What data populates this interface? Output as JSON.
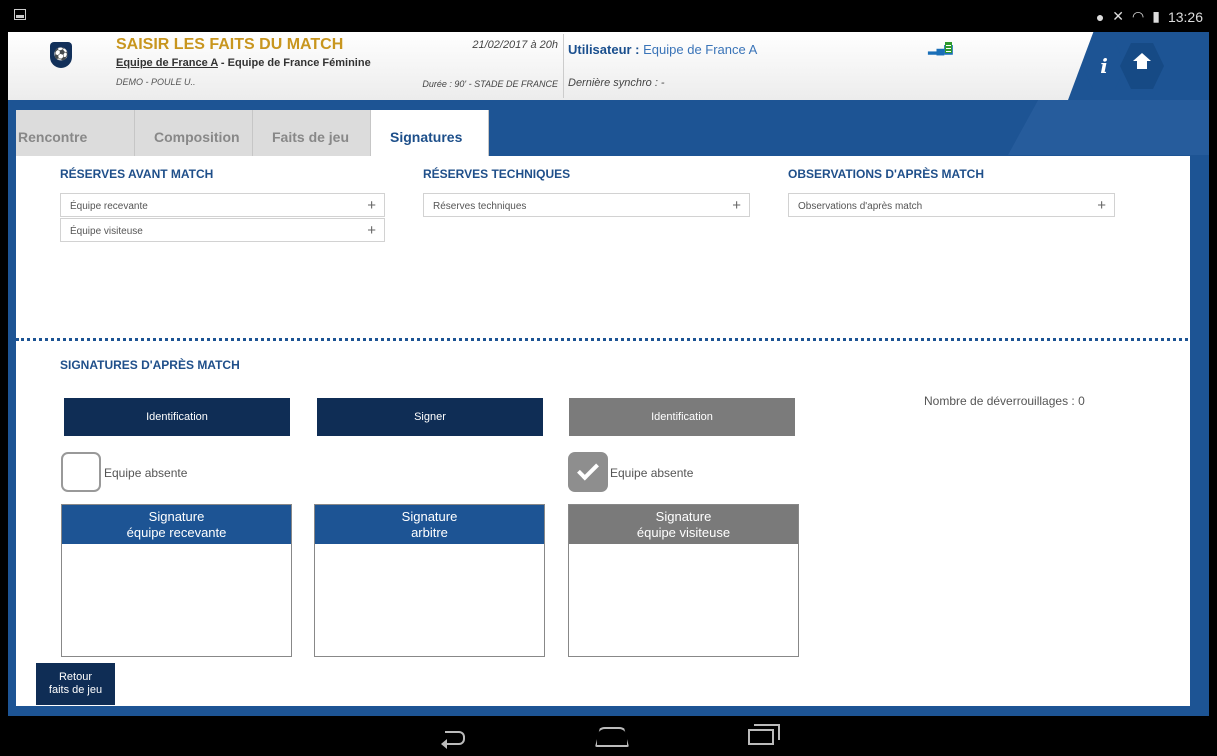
{
  "statusbar": {
    "time": "13:26"
  },
  "header": {
    "title": "SAISIR LES FAITS DU MATCH",
    "home_team": "Equipe de France A",
    "separator": " - ",
    "away_team": "Equipe de France Féminine",
    "competition": "DEMO - POULE U..",
    "date": "21/02/2017 à 20h",
    "venue": "Durée : 90' - STADE DE FRANCE",
    "user_label": "Utilisateur : ",
    "user_value": "Equipe de France A",
    "sync": "Dernière synchro : -",
    "info_label": "i"
  },
  "tabs": [
    "Rencontre",
    "Composition",
    "Faits de jeu",
    "Signatures"
  ],
  "reserves_avant": {
    "title": "RÉSERVES AVANT MATCH",
    "items": [
      "Équipe recevante",
      "Équipe visiteuse"
    ]
  },
  "reserves_tech": {
    "title": "RÉSERVES TECHNIQUES",
    "items": [
      "Réserves techniques"
    ]
  },
  "observations": {
    "title": "OBSERVATIONS D'APRÈS MATCH",
    "items": [
      "Observations d'après match"
    ]
  },
  "plus": "+",
  "signatures": {
    "title": "SIGNATURES D'APRÈS MATCH",
    "btn_identification_home": "Identification",
    "btn_signer": "Signer",
    "btn_identification_away": "Identification",
    "unlock_count": "Nombre de déverrouillages : 0",
    "absent_home": "Equipe absente",
    "absent_away": "Equipe absente",
    "box_home_line1": "Signature",
    "box_home_line2": "équipe recevante",
    "box_ref_line1": "Signature",
    "box_ref_line2": "arbitre",
    "box_away_line1": "Signature",
    "box_away_line2": "équipe visiteuse"
  },
  "back_button_line1": "Retour",
  "back_button_line2": "faits de jeu",
  "colors": {
    "primary": "#1d5494",
    "dark": "#0f2d55",
    "accent": "#c8961f",
    "disabled": "#7b7b7b"
  }
}
